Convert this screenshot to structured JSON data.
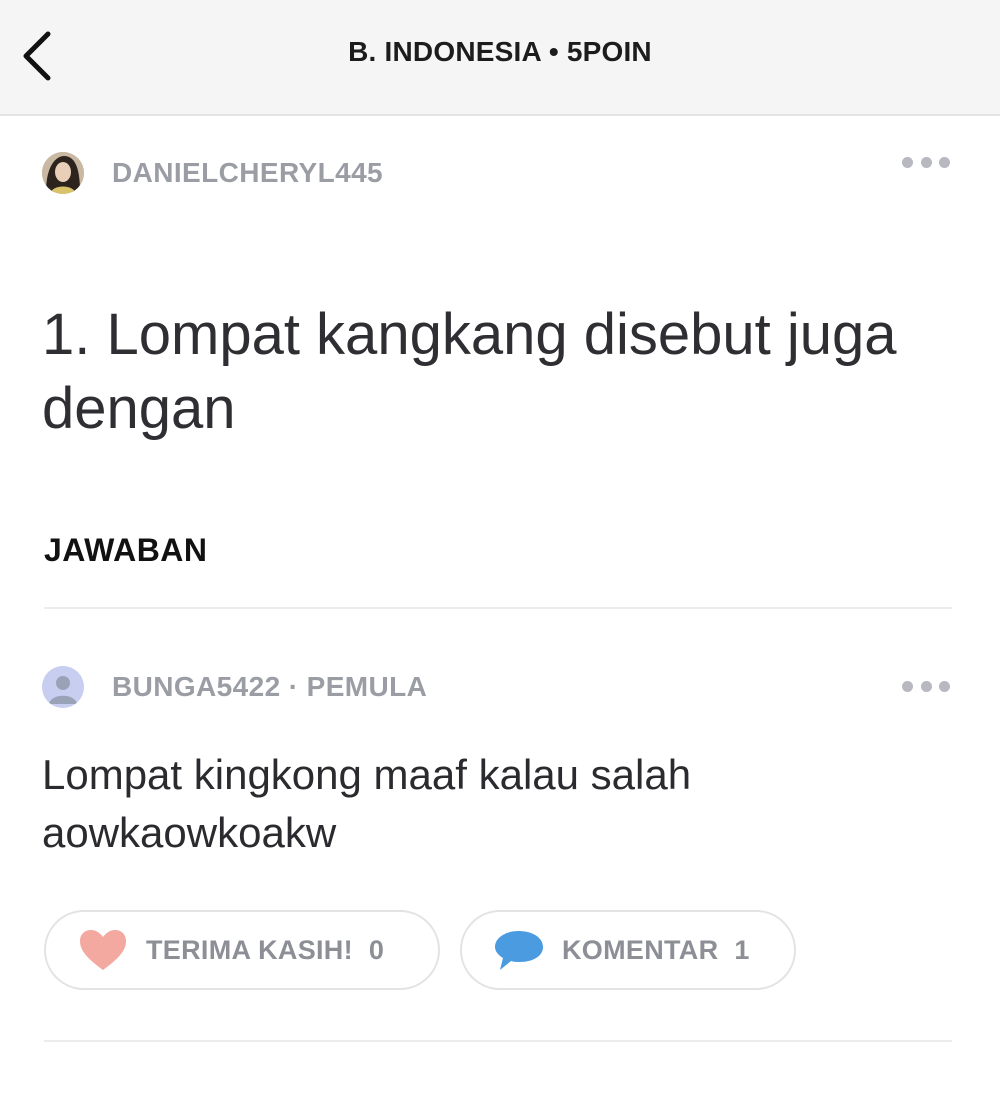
{
  "header": {
    "title": "B. INDONESIA • 5POIN",
    "back_icon": "chevron-left-icon"
  },
  "question": {
    "author": "DANIELCHERYL445",
    "text": "1. Lompat kangkang disebut juga dengan",
    "more_icon": "more-horizontal-icon"
  },
  "answers_section": {
    "heading": "JAWABAN"
  },
  "answer": {
    "author_line": "BUNGA5422 · PEMULA",
    "text": "Lompat kingkong maaf kalau salah aowkaowkoakw",
    "more_icon": "more-horizontal-icon",
    "thanks": {
      "label": "TERIMA KASIH!",
      "count": "0",
      "icon": "heart-icon",
      "color": "#f4a9a0"
    },
    "comment": {
      "label": "KOMENTAR",
      "count": "1",
      "icon": "comment-bubble-icon",
      "color": "#4a9be0"
    }
  }
}
